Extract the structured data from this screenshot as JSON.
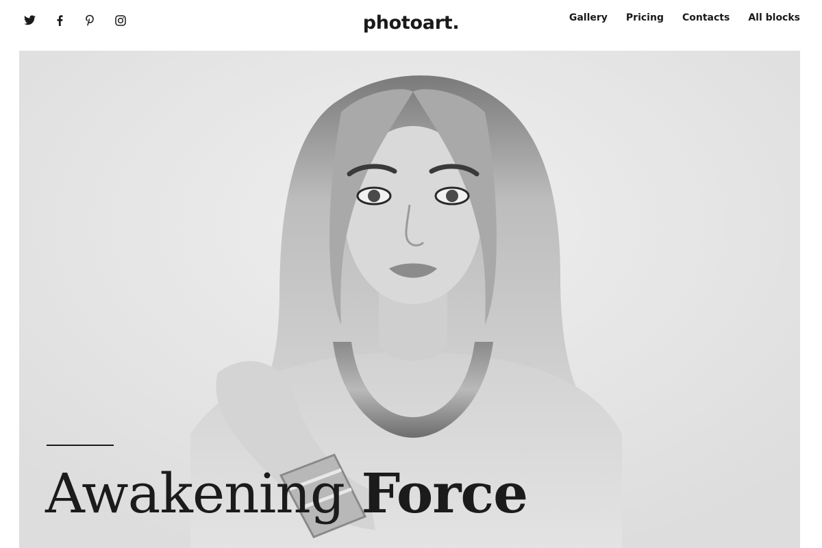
{
  "header": {
    "logo": "photoart.",
    "social": [
      {
        "name": "twitter-icon"
      },
      {
        "name": "facebook-icon"
      },
      {
        "name": "pinterest-icon"
      },
      {
        "name": "instagram-icon"
      }
    ],
    "nav": [
      {
        "label": "Gallery"
      },
      {
        "label": "Pricing"
      },
      {
        "label": "Contacts"
      },
      {
        "label": "All blocks"
      }
    ]
  },
  "hero": {
    "title_light": "Awakening",
    "title_bold": "Force"
  },
  "colors": {
    "text": "#1a1a1a",
    "background": "#ffffff",
    "hero_bg": "#e6e6e6"
  }
}
